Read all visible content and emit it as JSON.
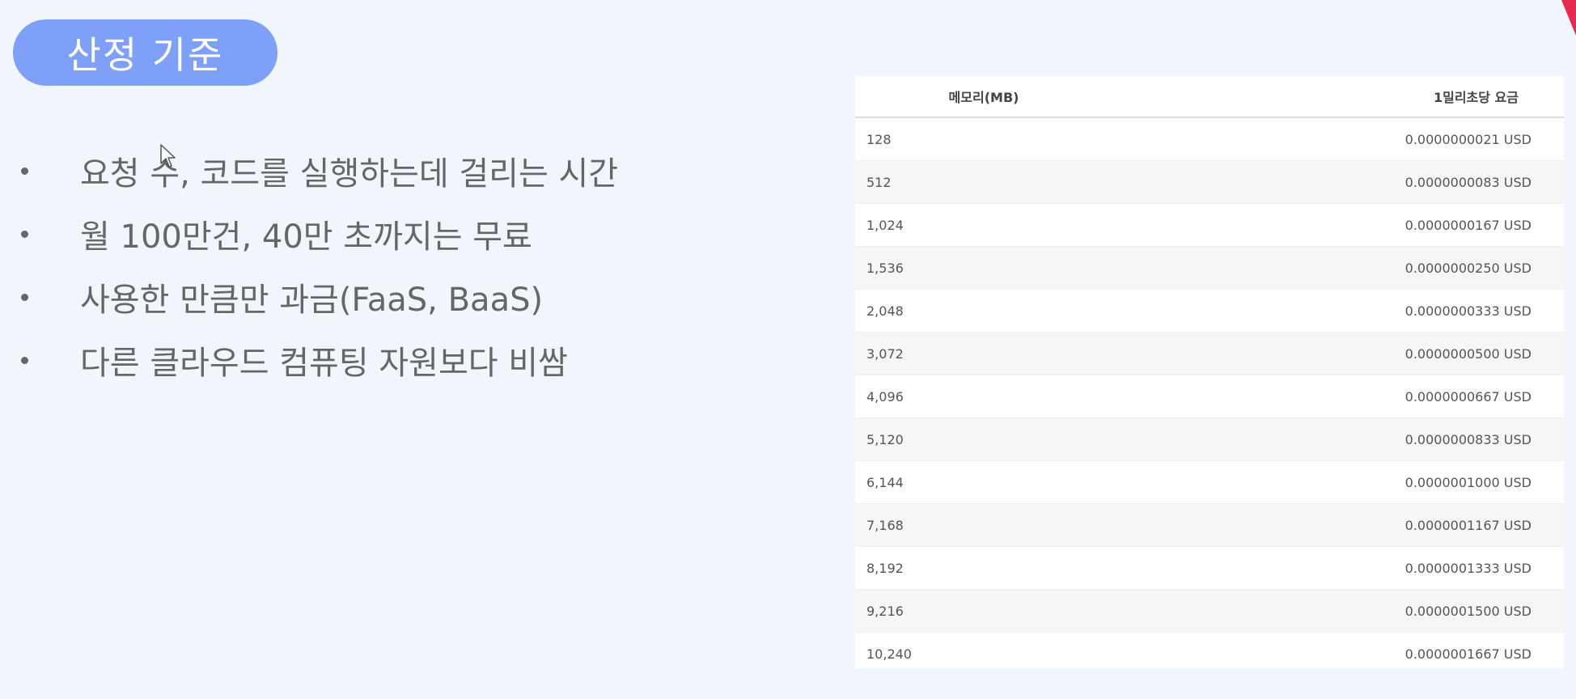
{
  "slide": {
    "title": "산정 기준",
    "bullets": [
      "요청 수, 코드를 실행하는데 걸리는 시간",
      "월 100만건, 40만 초까지는 무료",
      "사용한 만큼만 과금(FaaS, BaaS)",
      "다른 클라우드 컴퓨팅 자원보다 비쌈"
    ]
  },
  "table": {
    "headers": {
      "memory": "메모리(MB)",
      "price": "1밀리초당 요금"
    },
    "rows": [
      {
        "memory": "128",
        "price": "0.0000000021 USD"
      },
      {
        "memory": "512",
        "price": "0.0000000083 USD"
      },
      {
        "memory": "1,024",
        "price": "0.0000000167 USD"
      },
      {
        "memory": "1,536",
        "price": "0.0000000250 USD"
      },
      {
        "memory": "2,048",
        "price": "0.0000000333 USD"
      },
      {
        "memory": "3,072",
        "price": "0.0000000500 USD"
      },
      {
        "memory": "4,096",
        "price": "0.0000000667 USD"
      },
      {
        "memory": "5,120",
        "price": "0.0000000833 USD"
      },
      {
        "memory": "6,144",
        "price": "0.0000001000 USD"
      },
      {
        "memory": "7,168",
        "price": "0.0000001167 USD"
      },
      {
        "memory": "8,192",
        "price": "0.0000001333 USD"
      },
      {
        "memory": "9,216",
        "price": "0.0000001500 USD"
      },
      {
        "memory": "10,240",
        "price": "0.0000001667 USD"
      }
    ]
  },
  "colors": {
    "background": "#f1f6fd",
    "title_pill": "#7fa0f9",
    "corner_accent": "#e8294f"
  },
  "icons": {
    "cursor": "mouse-pointer-icon",
    "corner": "corner-accent-icon"
  }
}
